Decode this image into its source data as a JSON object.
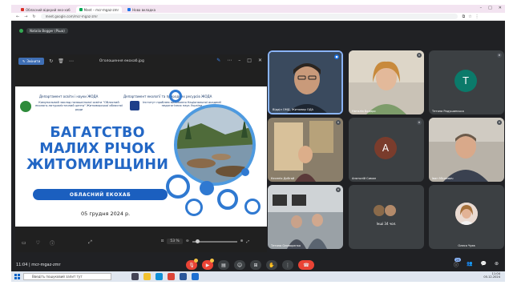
{
  "browser": {
    "tabs": [
      {
        "label": "Обласний відкрий еко-хаб",
        "active": false,
        "icon": "red"
      },
      {
        "label": "Meet – mcr-mgaz-zmr",
        "active": true,
        "icon": "green"
      },
      {
        "label": "Нова вкладка",
        "active": false,
        "icon": "blue"
      }
    ],
    "url": "meet.google.com/mcr-mgaz-zmr"
  },
  "meet": {
    "presenter_label": "Natalia Bogger (Ріша)",
    "meeting_time": "11:04",
    "meeting_code": "mcr-mgaz-zmr",
    "participant_count": "25"
  },
  "share_window": {
    "edit_label": "Змінити",
    "title": "Оголошення екохаб.jpg",
    "zoom": "53 %"
  },
  "slide": {
    "dept_left": "Департамент освіти і науки ЖОДА",
    "dept_right": "Департамент екології та природних ресурсів ЖОДА",
    "inst_left": "Комунальний заклад позашкільної освіти \"Обласний еколого-натуралістичний центр\" Житомирської обласної ради",
    "inst_right": "Інститут проблем виховання Національної академії педагогічних наук України",
    "title_lines": [
      "БАГАТСТВО",
      "МАЛИХ РІЧОК",
      "ЖИТОМИРЩИНИ"
    ],
    "hub": "ОБЛАСНИЙ ЕКОХАБ",
    "date": "05 грудня 2024 р."
  },
  "participants": [
    {
      "name": "Відділ ОМД, Житомир ОДА",
      "type": "video",
      "speaking": true
    },
    {
      "name": "Наталія Бодаро",
      "type": "video",
      "speaking": false
    },
    {
      "name": "Тетяна Радушинська",
      "type": "avatar",
      "initial": "T",
      "color": "#0b7a6a"
    },
    {
      "name": "Кесенія Добгай",
      "type": "video",
      "speaking": false
    },
    {
      "name": "Анатолій Симан",
      "type": "avatar",
      "initial": "A",
      "color": "#7a3c2c"
    },
    {
      "name": "Іван Місюєвич",
      "type": "video",
      "speaking": false
    },
    {
      "name": "Тетяна Оливорєнко",
      "type": "video",
      "speaking": false
    },
    {
      "name": "Інші 34 чол.",
      "type": "others"
    },
    {
      "name": "Олеся Чуєв",
      "type": "photo"
    }
  ],
  "taskbar": {
    "search_placeholder": "Введіть пошуковий запит тут",
    "time": "11:04",
    "date": "05.12.2024"
  }
}
